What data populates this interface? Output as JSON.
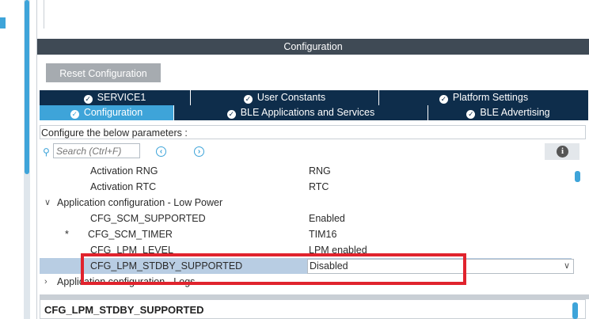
{
  "header": {
    "title": "Configuration"
  },
  "toolbar": {
    "reset_label": "Reset Configuration"
  },
  "tabs_row1": [
    {
      "label": "SERVICE1",
      "icon": "check-circle-icon"
    },
    {
      "label": "User Constants",
      "icon": "check-circle-icon"
    },
    {
      "label": "Platform Settings",
      "icon": "check-circle-icon"
    }
  ],
  "tabs_row2": [
    {
      "label": "Configuration",
      "icon": "check-circle-icon",
      "active": true
    },
    {
      "label": "BLE Applications and Services",
      "icon": "check-circle-icon"
    },
    {
      "label": "BLE Advertising",
      "icon": "check-circle-icon"
    }
  ],
  "params": {
    "label": "Configure the below parameters :"
  },
  "search": {
    "placeholder": "Search (Ctrl+F)"
  },
  "tree": {
    "rows": [
      {
        "name": "Activation RNG",
        "value": "RNG"
      },
      {
        "name": "Activation RTC",
        "value": "RTC"
      },
      {
        "group": "Application configuration - Low Power"
      },
      {
        "name": "CFG_SCM_SUPPORTED",
        "value": "Enabled"
      },
      {
        "name": "CFG_SCM_TIMER",
        "value": "TIM16",
        "modified": "*"
      },
      {
        "name": "CFG_LPM_LEVEL",
        "value": "LPM enabled"
      },
      {
        "name": "CFG_LPM_STDBY_SUPPORTED",
        "value": "Disabled",
        "selected": true
      },
      {
        "group": "Application configuration - Logs"
      }
    ]
  },
  "description": {
    "title": "CFG_LPM_STDBY_SUPPORTED"
  },
  "colors": {
    "accent": "#3ea4d9",
    "tab_dark": "#0e2d4b",
    "header_bar": "#3f4a55",
    "highlight": "#e0232d",
    "selection": "#b8cde3"
  }
}
